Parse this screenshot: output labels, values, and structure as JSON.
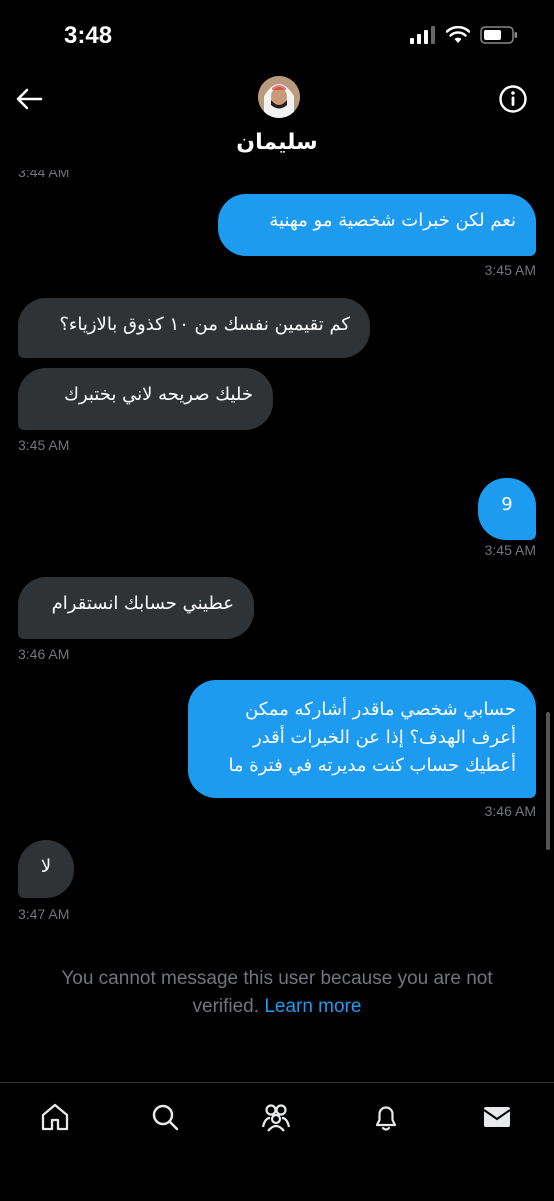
{
  "status_bar": {
    "time": "3:48"
  },
  "header": {
    "name": "سليمان"
  },
  "cut_timestamp": "3:44 AM",
  "messages": [
    {
      "text": "نعم لكن خبرات شخصية مو مهنية",
      "time": "3:45 AM"
    },
    {
      "text": "كم تقيمين نفسك من ١٠ كذوق بالازياء؟"
    },
    {
      "text": "خليك صريحه لاني بختبرك",
      "time": "3:45 AM"
    },
    {
      "text": "9",
      "time": "3:45 AM"
    },
    {
      "text": "عطيني حسابك انستقرام",
      "time": "3:46 AM"
    },
    {
      "lines": [
        "حسابي شخصي ماقدر أشاركه ممكن",
        "أعرف الهدف؟ إذا عن الخبرات أقدر",
        "أعطيك حساب كنت مديرته في فترة ما"
      ],
      "time": "3:46 AM"
    },
    {
      "text": "لا",
      "time": "3:47 AM"
    }
  ],
  "notice": {
    "text": "You cannot message this user because you are not verified.",
    "link": "Learn more"
  },
  "tabs": [
    "home-icon",
    "search-icon",
    "communities-icon",
    "notifications-icon",
    "messages-icon"
  ],
  "colors": {
    "accent": "#1d9bf0",
    "incoming_bubble": "#2f3336",
    "muted": "#71767b",
    "background": "#000000"
  }
}
